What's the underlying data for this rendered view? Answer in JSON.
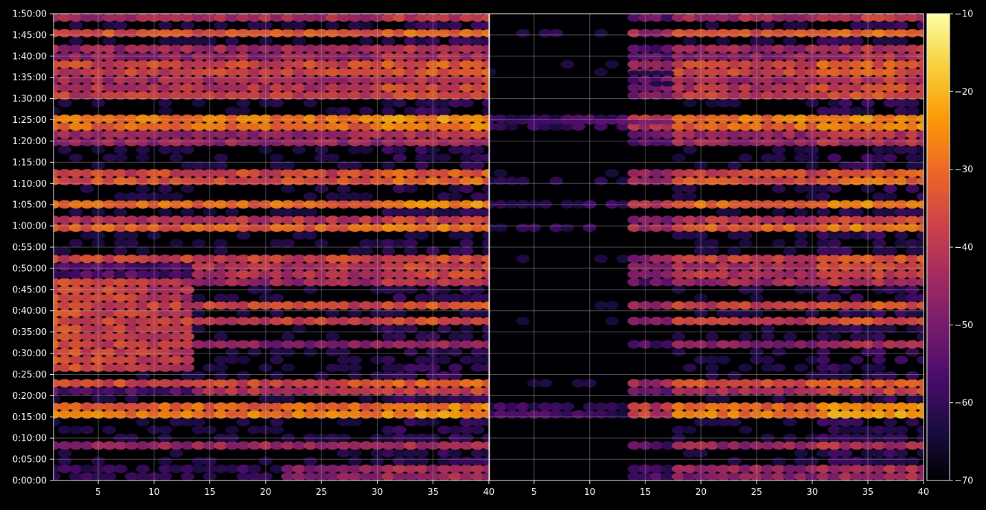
{
  "chart_data": {
    "type": "heatmap",
    "panels": [
      {
        "name": "left",
        "x_ticks": [
          5,
          10,
          15,
          20,
          25,
          30,
          35,
          40
        ],
        "xlim": [
          1,
          40
        ]
      },
      {
        "name": "right",
        "x_ticks": [
          5,
          10,
          15,
          20,
          25,
          30,
          35,
          40
        ],
        "xlim": [
          1,
          40
        ]
      }
    ],
    "y_ticks": [
      "0:00:00",
      "0:05:00",
      "0:10:00",
      "0:15:00",
      "0:20:00",
      "0:25:00",
      "0:30:00",
      "0:35:00",
      "0:40:00",
      "0:45:00",
      "0:50:00",
      "0:55:00",
      "1:00:00",
      "1:05:00",
      "1:10:00",
      "1:15:00",
      "1:20:00",
      "1:25:00",
      "1:30:00",
      "1:35:00",
      "1:40:00",
      "1:45:00",
      "1:50:00"
    ],
    "y_range_seconds": [
      0,
      6600
    ],
    "colorbar": {
      "ticks": [
        -10,
        -20,
        -30,
        -40,
        -50,
        -60,
        -70
      ],
      "range": [
        -70,
        -10
      ],
      "colormap": "inferno",
      "colors": [
        "#000004",
        "#1b0c41",
        "#4a0c6b",
        "#781c6d",
        "#a52c60",
        "#cf4446",
        "#ed6925",
        "#fb9b06",
        "#f7d13d",
        "#fcffa4"
      ]
    },
    "grid": true,
    "background": "#000000",
    "strong_band_minutes": [
      {
        "t": 2,
        "v": -42,
        "onset": 22
      },
      {
        "t": 8.5,
        "v": -44,
        "onset": 1
      },
      {
        "t": 15.5,
        "v": -28,
        "onset": 1
      },
      {
        "t": 17.5,
        "v": -30,
        "onset": 1
      },
      {
        "t": 20.5,
        "v": -38,
        "onset": 14
      },
      {
        "t": 23.5,
        "v": -32,
        "onset": 1
      },
      {
        "t": 31.5,
        "v": -44,
        "onset": 1
      },
      {
        "t": 37.5,
        "v": -38,
        "onset": 1
      },
      {
        "t": 41,
        "v": -36,
        "onset": 1
      },
      {
        "t": 47.5,
        "v": -40,
        "onset": 1
      },
      {
        "t": 49.5,
        "v": -36,
        "onset": 14
      },
      {
        "t": 52.5,
        "v": -36,
        "onset": 1
      },
      {
        "t": 60,
        "v": -30,
        "onset": 1
      },
      {
        "t": 61.5,
        "v": -40,
        "onset": 1
      },
      {
        "t": 65,
        "v": -30,
        "onset": 1
      },
      {
        "t": 71,
        "v": -32,
        "onset": 1
      },
      {
        "t": 72.5,
        "v": -36,
        "onset": 1
      },
      {
        "t": 79.5,
        "v": -44,
        "onset": 1
      },
      {
        "t": 82,
        "v": -42,
        "onset": 1
      },
      {
        "t": 84.5,
        "v": -24,
        "onset": 1
      },
      {
        "t": 91.5,
        "v": -34,
        "onset": 1
      },
      {
        "t": 93.5,
        "v": -38,
        "onset": 1
      },
      {
        "t": 96,
        "v": -36,
        "onset": 1
      },
      {
        "t": 98.5,
        "v": -34,
        "onset": 1
      },
      {
        "t": 101,
        "v": -40,
        "onset": 1
      },
      {
        "t": 105.5,
        "v": -34,
        "onset": 1
      },
      {
        "t": 110,
        "v": -38,
        "onset": 1
      }
    ]
  }
}
